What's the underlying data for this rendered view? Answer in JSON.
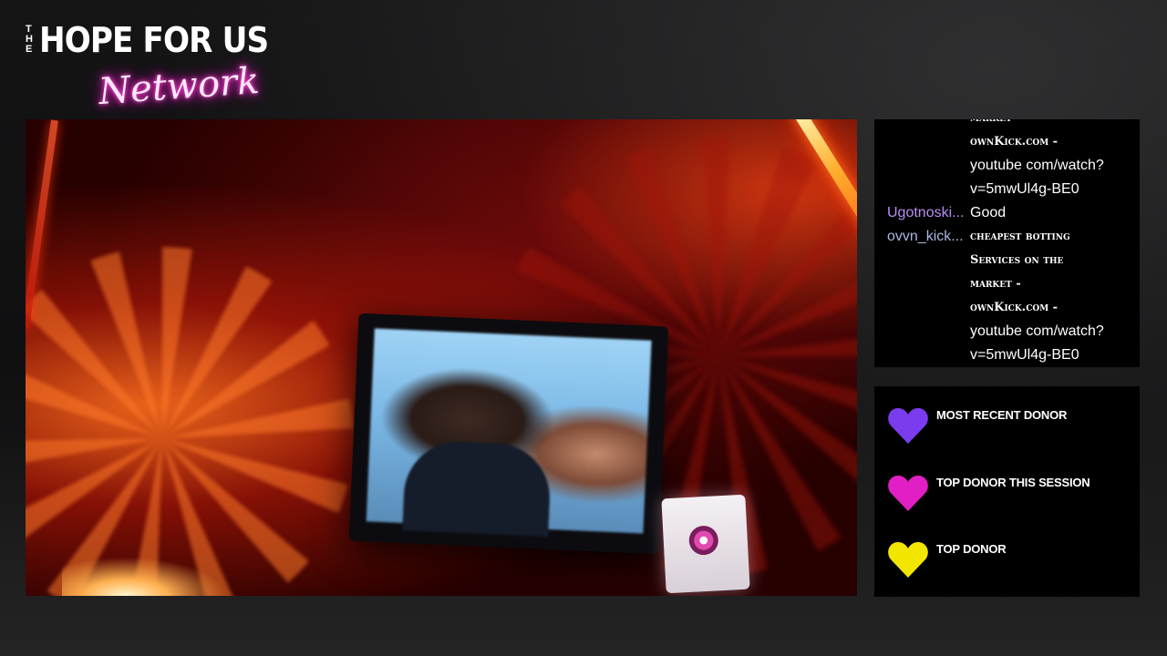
{
  "logo": {
    "the": "THE",
    "main": "HOPE FOR US",
    "script": "Network",
    "colors": {
      "main": "#ffffff",
      "neon": "#ff2fd0"
    }
  },
  "video": {
    "description_icon": "video-feed"
  },
  "chat": {
    "messages": [
      {
        "user": "",
        "user_color": "#ffffff",
        "lines": [
          {
            "text": "market",
            "style": "sc"
          },
          {
            "text": "ownKick.com -",
            "style": "sc"
          },
          {
            "text": "youtube com/watch?",
            "style": "plain"
          },
          {
            "text": "v=5mwUl4g-BE0",
            "style": "plain"
          }
        ]
      },
      {
        "user": "Ugotnoski...",
        "user_color": "#b98df2",
        "lines": [
          {
            "text": "Good",
            "style": "plain"
          }
        ]
      },
      {
        "user": "ovvn_kick...",
        "user_color": "#a9b6e0",
        "lines": [
          {
            "text": "cheapest botting",
            "style": "sc"
          },
          {
            "text": "Services on the",
            "style": "sc"
          },
          {
            "text": "market -",
            "style": "sc"
          },
          {
            "text": "ownKick.com -",
            "style": "sc"
          },
          {
            "text": "youtube com/watch?",
            "style": "plain"
          },
          {
            "text": "v=5mwUl4g-BE0",
            "style": "plain"
          }
        ]
      }
    ]
  },
  "donors": {
    "items": [
      {
        "label": "MOST RECENT DONOR",
        "heart_color": "#7b3cf0",
        "icon": "heart-icon-purple"
      },
      {
        "label": "TOP DONOR THIS SESSION",
        "heart_color": "#e21fc4",
        "icon": "heart-icon-pink"
      },
      {
        "label": "TOP DONOR",
        "heart_color": "#f2e600",
        "icon": "heart-icon-yellow"
      }
    ]
  }
}
